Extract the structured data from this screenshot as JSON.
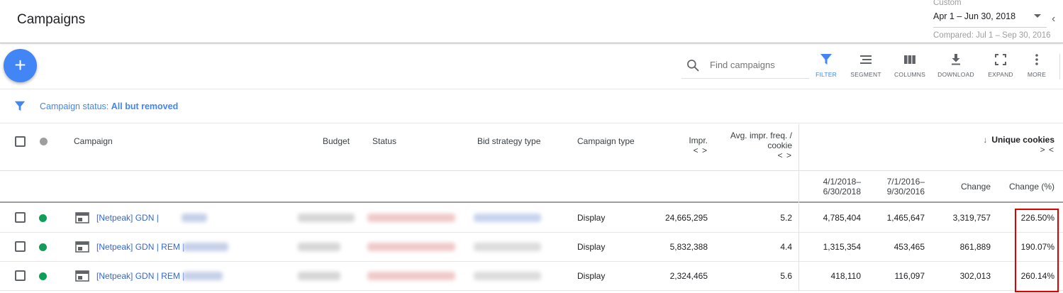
{
  "header": {
    "title": "Campaigns",
    "date_label": "Custom",
    "date_range": "Apr 1 – Jun 30, 2018",
    "compared": "Compared: Jul 1 – Sep 30, 2016"
  },
  "toolbar": {
    "add_label": "+",
    "search_placeholder": "Find campaigns",
    "tools": [
      {
        "label": "FILTER",
        "icon": "filter-icon"
      },
      {
        "label": "SEGMENT",
        "icon": "segment-icon"
      },
      {
        "label": "COLUMNS",
        "icon": "columns-icon"
      },
      {
        "label": "DOWNLOAD",
        "icon": "download-icon"
      },
      {
        "label": "EXPAND",
        "icon": "expand-icon"
      },
      {
        "label": "MORE",
        "icon": "more-vert-icon"
      }
    ]
  },
  "filter": {
    "label": "Campaign status:",
    "value": "All but removed"
  },
  "table": {
    "headers": {
      "campaign": "Campaign",
      "budget": "Budget",
      "status": "Status",
      "bid_strategy": "Bid strategy type",
      "campaign_type": "Campaign type",
      "impr": "Impr.",
      "avg_freq_1": "Avg. impr. freq. /",
      "avg_freq_2": "cookie",
      "unique_cookies": "Unique cookies",
      "period1_1": "4/1/2018–",
      "period1_2": "6/30/2018",
      "period2_1": "7/1/2016–",
      "period2_2": "9/30/2016",
      "change": "Change",
      "change_pct": "Change (%)",
      "expand_glyph": "< >",
      "collapse_glyph": "> <"
    },
    "rows": [
      {
        "campaign": "[Netpeak] GDN |",
        "type": "Display",
        "impr": "24,665,295",
        "freq": "5.2",
        "p1": "4,785,404",
        "p2": "1,465,647",
        "change": "3,319,757",
        "change_pct": "226.50%"
      },
      {
        "campaign": "[Netpeak] GDN | REM |",
        "type": "Display",
        "impr": "5,832,388",
        "freq": "4.4",
        "p1": "1,315,354",
        "p2": "453,465",
        "change": "861,889",
        "change_pct": "190.07%"
      },
      {
        "campaign": "[Netpeak] GDN | REM |",
        "type": "Display",
        "impr": "2,324,465",
        "freq": "5.6",
        "p1": "418,110",
        "p2": "116,097",
        "change": "302,013",
        "change_pct": "260.14%"
      }
    ]
  },
  "colors": {
    "accent": "#4285f4",
    "status_enabled": "#0f9d58",
    "highlight": "#e00000",
    "link": "#3367d6"
  }
}
